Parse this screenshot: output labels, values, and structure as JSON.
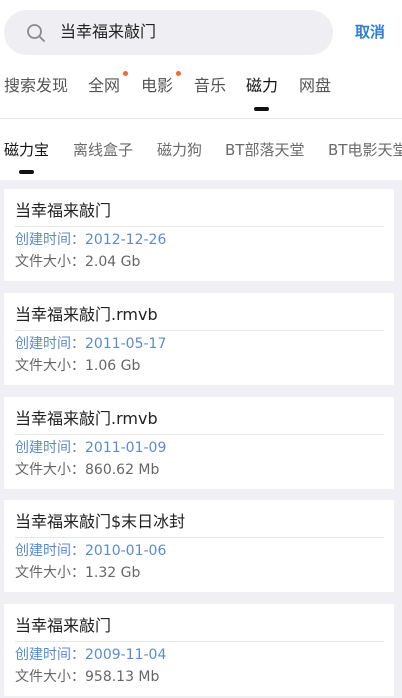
{
  "search": {
    "query": "当幸福来敲门",
    "cancel_label": "取消"
  },
  "category_tabs": [
    {
      "label": "搜索发现",
      "active": false,
      "dot": false
    },
    {
      "label": "全网",
      "active": false,
      "dot": true
    },
    {
      "label": "电影",
      "active": false,
      "dot": true
    },
    {
      "label": "音乐",
      "active": false,
      "dot": false
    },
    {
      "label": "磁力",
      "active": true,
      "dot": false
    },
    {
      "label": "网盘",
      "active": false,
      "dot": false
    }
  ],
  "source_tabs": [
    {
      "label": "磁力宝",
      "active": true
    },
    {
      "label": "离线盒子",
      "active": false
    },
    {
      "label": "磁力狗",
      "active": false
    },
    {
      "label": "BT部落天堂",
      "active": false
    },
    {
      "label": "BT电影天堂",
      "active": false
    }
  ],
  "results": [
    {
      "title": "当幸福来敲门",
      "date": "创建时间：2012-12-26",
      "size": "文件大小：2.04 Gb"
    },
    {
      "title": "当幸福来敲门.rmvb",
      "date": "创建时间：2011-05-17",
      "size": "文件大小：1.06 Gb"
    },
    {
      "title": "当幸福来敲门.rmvb",
      "date": "创建时间：2011-01-09",
      "size": "文件大小：860.62 Mb"
    },
    {
      "title": "当幸福来敲门$末日冰封",
      "date": "创建时间：2010-01-06",
      "size": "文件大小：1.32 Gb"
    },
    {
      "title": "当幸福来敲门",
      "date": "创建时间：2009-11-04",
      "size": "文件大小：958.13 Mb"
    }
  ],
  "colors": {
    "accent": "#2f7fd6",
    "date_text": "#5b8bd0",
    "dot": "#f06a35",
    "background": "#efeff4"
  }
}
